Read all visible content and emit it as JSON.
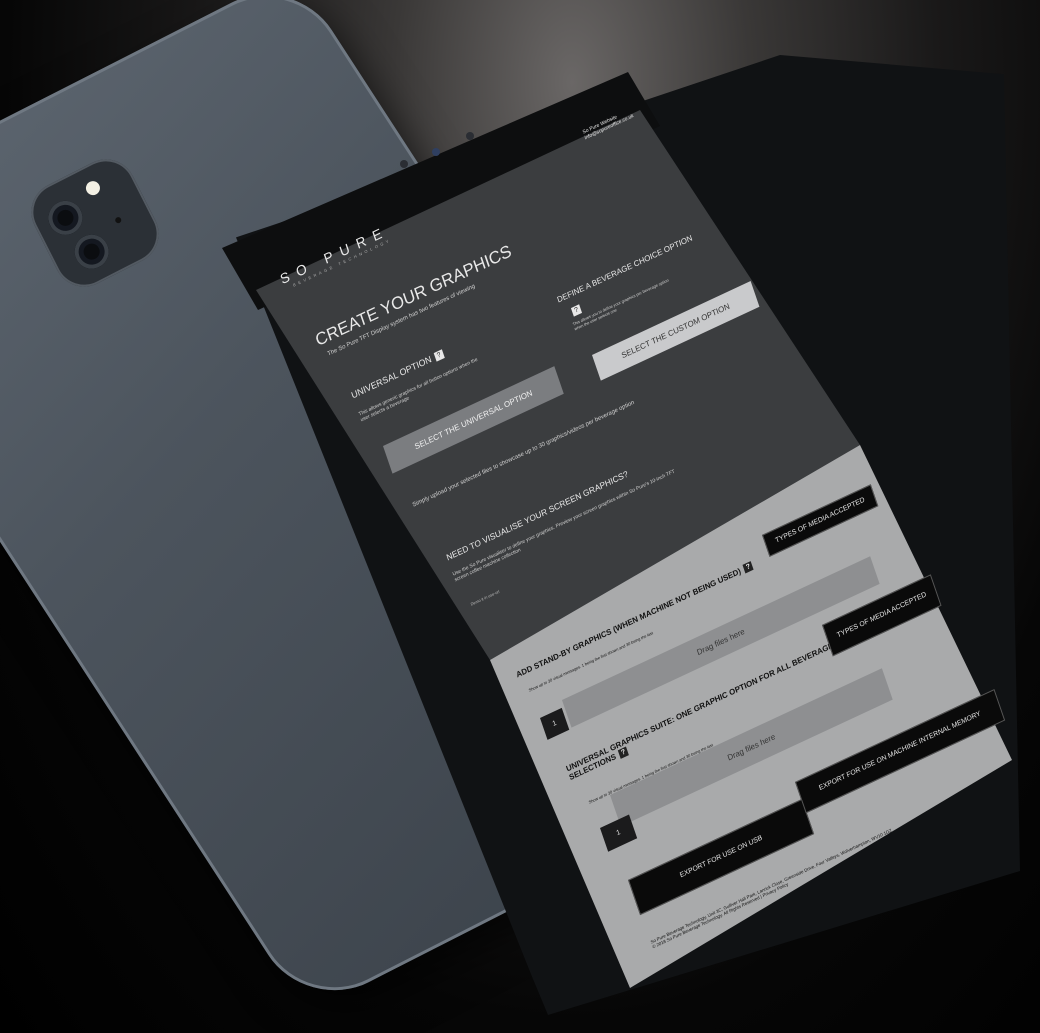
{
  "header": {
    "logo_text": "SO PURE",
    "logo_sub": "BEVERAGE TECHNOLOGY",
    "contact_line1": "So Pure Website",
    "contact_line2": "info@sopureoffice.co.uk"
  },
  "create": {
    "title": "CREATE YOUR GRAPHICS",
    "subtitle": "The So Pure TFT Display system has two features of viewing",
    "universal_title": "UNIVERSAL OPTION",
    "universal_desc1": "This allows generic graphics for all button options when the",
    "universal_desc2": "user selects a beverage",
    "universal_button": "SELECT THE UNIVERSAL OPTION",
    "define_title": "DEFINE A BEVERAGE CHOICE OPTION",
    "define_desc1": "This allows you to define your graphics per beverage option",
    "define_desc2": "when the user selects one",
    "define_button": "SELECT THE CUSTOM OPTION",
    "upload_note": "Simply upload your selected files to showcase up to 30 graphics/videos per beverage option"
  },
  "visualise": {
    "title": "NEED TO VISUALISE YOUR SCREEN GRAPHICS?",
    "desc1": "Use the So Pure visualiser to define your graphics. Preview your screen graphics within So Pure's 10-inch TFT",
    "desc2": "screen coffee machine collection",
    "link": "Demo it in use-url"
  },
  "standby": {
    "title": "ADD STAND-BY GRAPHICS (WHEN MACHINE NOT BEING USED)",
    "desc": "Show up to 30 visual messages. 1 being the first shown and 30 being the last",
    "media_button": "TYPES OF MEDIA ACCEPTED",
    "drop_label": "Drag files here",
    "count": "1"
  },
  "suite": {
    "title_line1": "UNIVERSAL GRAPHICS SUITE: ONE GRAPHIC OPTION FOR ALL BEVERAGE",
    "title_line2": "SELECTIONS",
    "desc": "Show up to 30 visual messages. 1 being the first shown and 30 being the last",
    "media_button": "TYPES OF MEDIA ACCEPTED",
    "drop_label": "Drag files here",
    "count": "1"
  },
  "export": {
    "usb_button": "EXPORT FOR USE ON USB",
    "memory_button": "EXPORT FOR USE ON MACHINE INTERNAL MEMORY"
  },
  "footer": {
    "line1": "So Pure Beverage Technology, Unit 3C, Gulliver Hall Park, Lanrick Close, Greenside Drive, Four Valleys, Wolverhampton, WV10 1DZ",
    "line2": "© 2018 So Pure Beverage Technology. All Rights Reserved | Privacy Policy"
  }
}
